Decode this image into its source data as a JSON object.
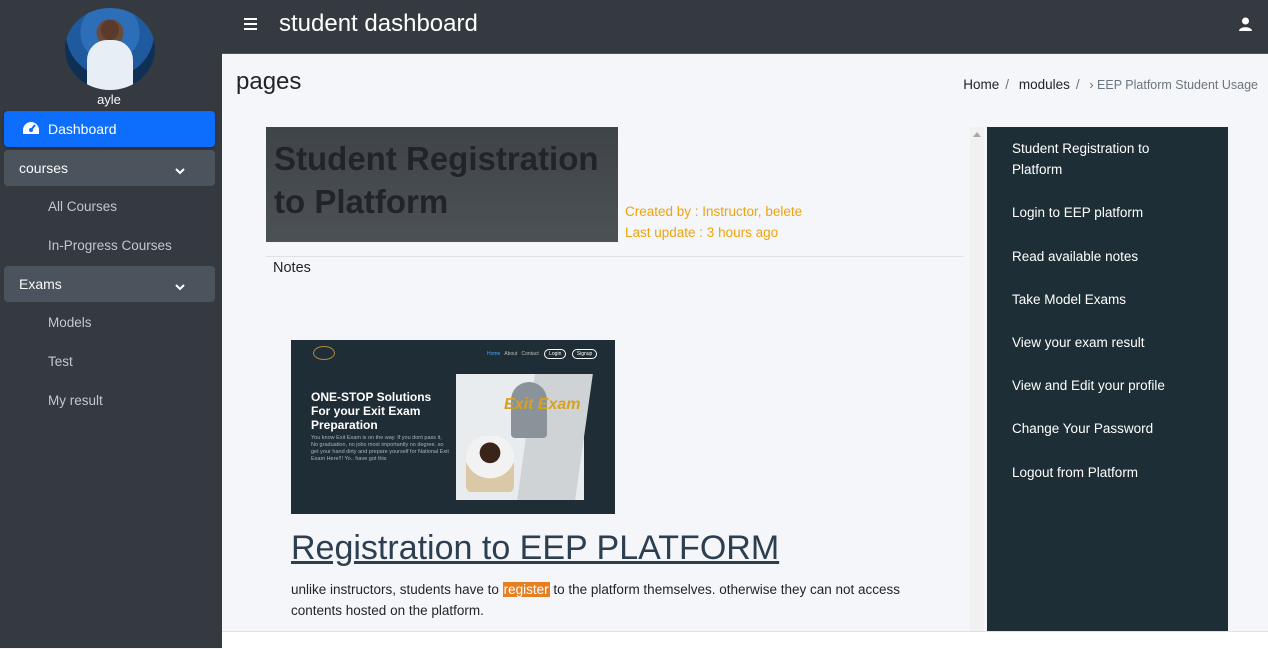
{
  "sidebar": {
    "user_name": "ayle",
    "dashboard_label": "Dashboard",
    "groups": [
      {
        "label": "courses",
        "items": [
          "All Courses",
          "In-Progress Courses"
        ]
      },
      {
        "label": "Exams",
        "items": [
          "Models",
          "Test",
          "My result"
        ]
      }
    ]
  },
  "header": {
    "title": "student dashboard",
    "menu_icon": "hamburger-icon",
    "user_icon": "user-icon"
  },
  "page": {
    "title": "pages",
    "breadcrumb": [
      "Home",
      "modules",
      "› EEP Platform Student Usage"
    ]
  },
  "article": {
    "hero_title": "Student Registration to Platform",
    "created_by": "Created by : Instructor, belete",
    "last_update": "Last update : 3 hours ago",
    "notes_label": "Notes",
    "image": {
      "nav": [
        "Home",
        "About",
        "Contact"
      ],
      "login": "Login",
      "signup": "Signup",
      "headline": "ONE-STOP Solutions For your Exit Exam Preparation",
      "body": "You know Exit Exam is on the way. If you dont pass it, No graduation, no jobs most importantly no degree. so get your hand dirty and prepare yourself for National Exit Exam Here!!! Yo.. have got this",
      "brand": "Exit Exam"
    },
    "heading": "Registration to EEP PLATFORM",
    "para_before": "unlike instructors, students have to ",
    "para_highlight": "register",
    "para_after": " to the platform themselves. otherwise they can not access contents hosted on the platform."
  },
  "toc": [
    "Student Registration to Platform",
    "Login to EEP platform",
    "Read available notes",
    "Take Model Exams",
    "View your exam result",
    "View and Edit your profile",
    "Change Your Password",
    "Logout from Platform"
  ],
  "colors": {
    "sidebar_bg": "#343a40",
    "active_nav": "#0d6efd",
    "meta_text": "#f0a30a",
    "highlight": "#e67e22",
    "toc_bg": "#1d2e37"
  }
}
